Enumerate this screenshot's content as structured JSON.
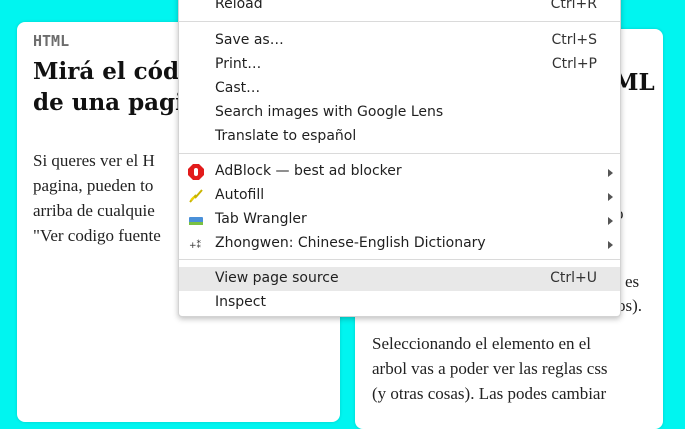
{
  "left_card": {
    "tag": "HTML",
    "heading_line1": "Mirá el códi",
    "heading_line2": "de una pagin",
    "body": [
      "Si queres ver el H",
      "pagina, pueden to",
      "arriba de cualquie",
      "\"Ver codigo fuente"
    ]
  },
  "right_card": {
    "heading_fragment": "ML",
    "frag1": "o",
    "frag2": "es",
    "frag3": "os).",
    "paragraph": [
      "Seleccionando el elemento en el",
      "arbol vas a poder ver las reglas css",
      "(y otras cosas). Las podes cambiar"
    ]
  },
  "context_menu": {
    "items": [
      {
        "label": "Reload",
        "shortcut": "Ctrl+R"
      },
      {
        "label": "Save as…",
        "shortcut": "Ctrl+S"
      },
      {
        "label": "Print…",
        "shortcut": "Ctrl+P"
      },
      {
        "label": "Cast…",
        "shortcut": ""
      },
      {
        "label": "Search images with Google Lens",
        "shortcut": ""
      },
      {
        "label": "Translate to español",
        "shortcut": ""
      },
      {
        "label": "AdBlock — best ad blocker",
        "icon": "adblock-icon"
      },
      {
        "label": "Autofill",
        "icon": "autofill-icon"
      },
      {
        "label": "Tab Wrangler",
        "icon": "tab-wrangler-icon"
      },
      {
        "label": "Zhongwen: Chinese-English Dictionary",
        "icon": "zhongwen-icon"
      },
      {
        "label": "View page source",
        "shortcut": "Ctrl+U"
      },
      {
        "label": "Inspect",
        "shortcut": ""
      }
    ]
  },
  "colors": {
    "background": "#00f5f0",
    "highlight": "#e8e8e8",
    "adblock": "#e21b1b"
  }
}
